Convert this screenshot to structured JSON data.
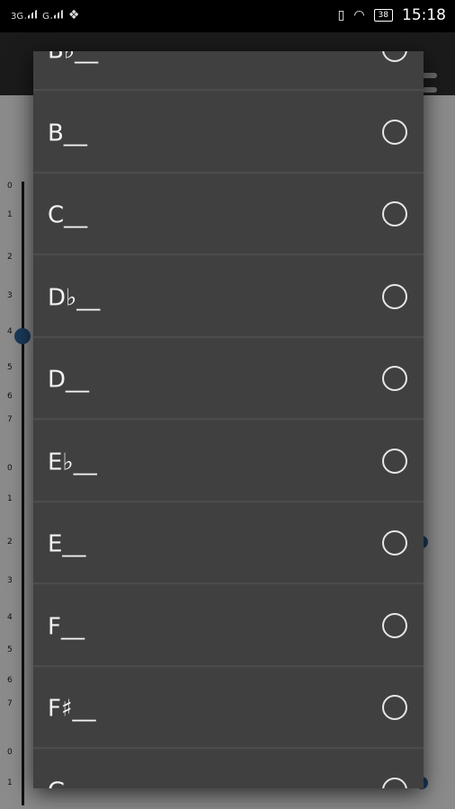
{
  "status_bar": {
    "network_1": "3G",
    "network_2": "G",
    "battery": "38",
    "time": "15:18"
  },
  "background_app": {
    "string_numbers_top": [
      "0",
      "1",
      "2",
      "3",
      "4",
      "5",
      "6",
      "7"
    ],
    "string_numbers_mid": [
      "0",
      "1",
      "2",
      "3",
      "4",
      "5",
      "6",
      "7"
    ],
    "string_numbers_bottom": [
      "0",
      "1"
    ],
    "accent_color": "#1a3a5a"
  },
  "dialog": {
    "options": [
      {
        "label": "B♭__",
        "selected": false
      },
      {
        "label": "B__",
        "selected": false
      },
      {
        "label": "C__",
        "selected": false
      },
      {
        "label": "D♭__",
        "selected": false
      },
      {
        "label": "D__",
        "selected": false
      },
      {
        "label": "E♭__",
        "selected": false
      },
      {
        "label": "E__",
        "selected": false
      },
      {
        "label": "F__",
        "selected": false
      },
      {
        "label": "F♯__",
        "selected": false
      },
      {
        "label": "G__",
        "selected": false
      }
    ]
  }
}
